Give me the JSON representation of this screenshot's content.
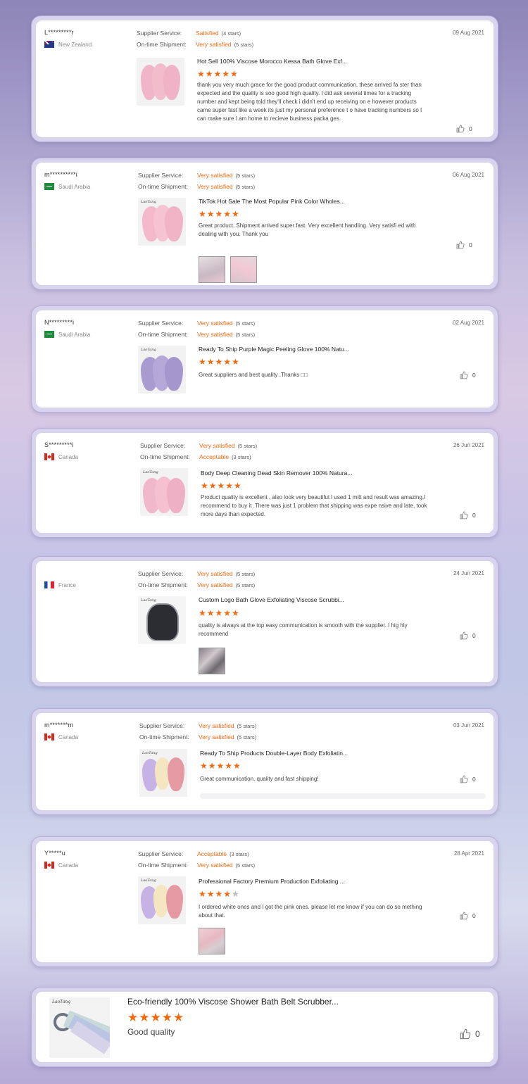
{
  "labels": {
    "supplier_service": "Supplier Service:",
    "ontime_shipment": "On-time Shipment:"
  },
  "colors": {
    "accent": "#f06a12",
    "card_border": "#d8d4ee"
  },
  "reviews": [
    {
      "user": "L*********r",
      "country": "New Zealand",
      "flag": "nz",
      "date": "09 Aug 2021",
      "supplier_val": "Satisfied",
      "supplier_stars": "(4 stars)",
      "shipment_val": "Very satisfied",
      "shipment_stars": "(5 stars)",
      "product": "Hot Sell 100% Viscose Morocco Kessa Bath Glove Exf...",
      "rating": 5,
      "text": "thank you very much grace for the good product communication, these arrived fa ster than expected and the quality is soo good high quality. I did ask several times for a tracking number and kept being told they'll check i didn't end up receiving on e however products came super fast like a week its just my personal preference t o have tracking numbers so I can make sure I am home to recieve business packa ges.",
      "likes": "0"
    },
    {
      "user": "m**********i",
      "country": "Saudi Arabia",
      "flag": "sa",
      "date": "06 Aug 2021",
      "supplier_val": "Very satisfied",
      "supplier_stars": "(5 stars)",
      "shipment_val": "Very satisfied",
      "shipment_stars": "(5 stars)",
      "product": "TikTok Hot Sale The Most Popular Pink Color Wholes...",
      "rating": 5,
      "text": "Great product.  Shipment arrived super fast.  Very excellent handling.  Very satisfi ed with dealing with you. Thank you",
      "likes": "0"
    },
    {
      "user": "N*********i",
      "country": "Saudi Arabia",
      "flag": "sa",
      "date": "02 Aug 2021",
      "supplier_val": "Very satisfied",
      "supplier_stars": "(5 stars)",
      "shipment_val": "Very satisfied",
      "shipment_stars": "(5 stars)",
      "product": "Ready To Ship Purple Magic Peeling Glove 100% Natu...",
      "rating": 5,
      "text": "Great suppliers and best quality .Thanks □□",
      "likes": "0"
    },
    {
      "user": "S*********i",
      "country": "Canada",
      "flag": "ca",
      "date": "26 Jun 2021",
      "supplier_val": "Very satisfied",
      "supplier_stars": "(5 stars)",
      "shipment_val": "Acceptable",
      "shipment_stars": "(3 stars)",
      "product": "Body Deep Cleaning Dead Skin Remover 100% Natura...",
      "rating": 5,
      "text": "Product quality is excellent , also look very beautiful.I used 1 mitt and result  was amazing,I recommend to buy it .There was just 1 problem that shipping was expe nsive and late, took more days than expected.",
      "likes": "0"
    },
    {
      "user": "",
      "country": "France",
      "flag": "fr",
      "date": "24 Jun 2021",
      "supplier_val": "Very satisfied",
      "supplier_stars": "(5 stars)",
      "shipment_val": "Very satisfied",
      "shipment_stars": "(5 stars)",
      "product": "Custom Logo Bath Glove Exfoliating Viscose Scrubbi...",
      "rating": 5,
      "text": "quality is always at the top easy communication is smooth with the supplier. I hig hly recommend",
      "likes": "0"
    },
    {
      "user": "m*******m",
      "country": "Canada",
      "flag": "ca",
      "date": "03 Jun 2021",
      "supplier_val": "Very satisfied",
      "supplier_stars": "(5 stars)",
      "shipment_val": "Very satisfied",
      "shipment_stars": "(5 stars)",
      "product": "Ready To Ship Products Double-Layer Body Exfoliatin...",
      "rating": 5,
      "text": "Great communication, quality and fast shipping!",
      "likes": "0"
    },
    {
      "user": "Y*****u",
      "country": "Canada",
      "flag": "ca",
      "date": "28 Apr 2021",
      "supplier_val": "Acceptable",
      "supplier_stars": "(3 stars)",
      "shipment_val": "Very satisfied",
      "shipment_stars": "(5 stars)",
      "product": "Professional Factory Premium Production Exfoliating ...",
      "rating": 4,
      "text": "I ordered white ones and I got the pink ones. please let me know if you can do so mething about that.",
      "likes": "0"
    },
    {
      "product": "Eco-friendly 100% Viscose Shower Bath Belt Scrubber...",
      "rating": 5,
      "text": "Good quality",
      "likes": "0"
    }
  ],
  "brand_mark": "LaoTang"
}
